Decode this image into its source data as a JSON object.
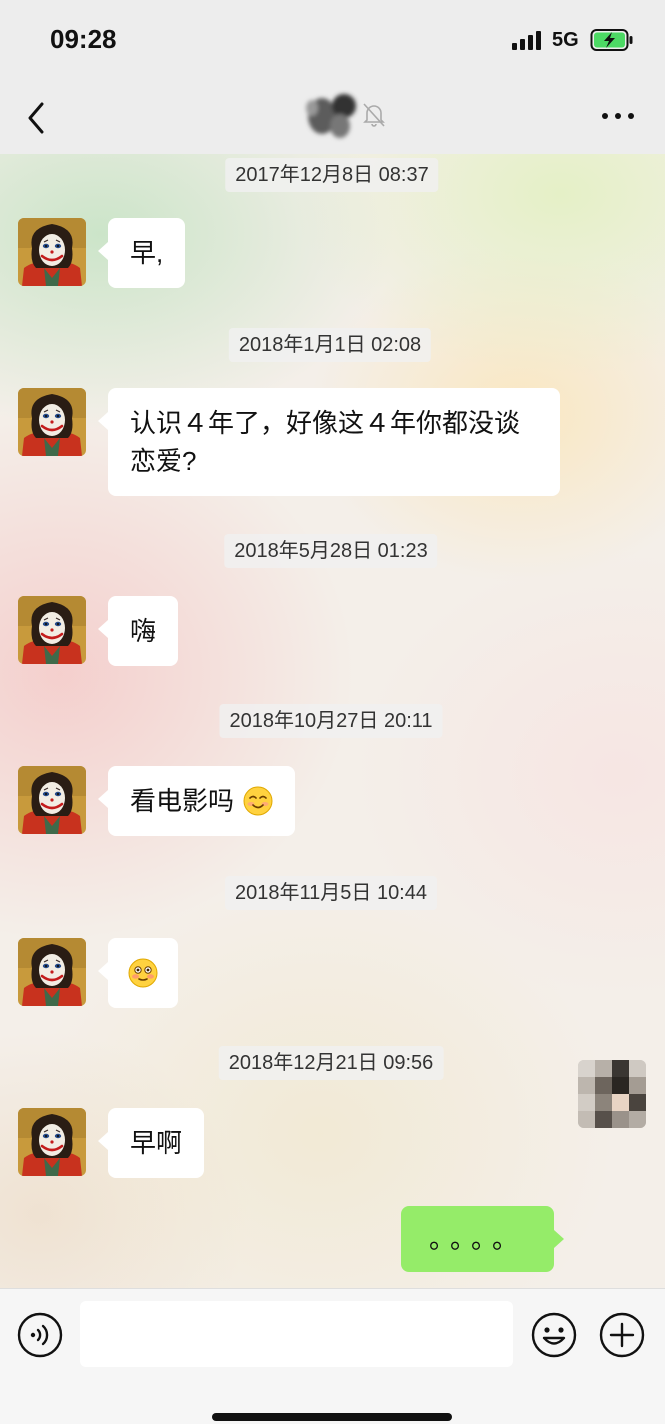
{
  "status_bar": {
    "time": "09:28",
    "network": "5G",
    "icons": [
      "signal-icon",
      "battery-charging-icon"
    ]
  },
  "nav_bar": {
    "icons": [
      "back-icon",
      "mute-icon",
      "more-icon"
    ]
  },
  "messages": [
    {
      "timestamp": "2017年12月8日 08:37",
      "text": "早,"
    },
    {
      "timestamp": "2018年1月1日 02:08",
      "text_line1": "认识４年了，好像这４年你都没谈",
      "text_line2": "恋爱?"
    },
    {
      "timestamp": "2018年5月28日 01:23",
      "text": "嗨"
    },
    {
      "timestamp": "2018年10月27日 20:11",
      "text": "看电影吗",
      "emoji": "smiling-face-icon"
    },
    {
      "timestamp": "2018年11月5日 10:44",
      "emoji": "flushed-face-icon"
    },
    {
      "timestamp": "2018年12月21日 09:56",
      "text": "早啊"
    }
  ],
  "my_message": {
    "text": "。。。。"
  },
  "input_bar": {
    "placeholder": "",
    "icons": [
      "voice-icon",
      "emoji-icon",
      "plus-icon"
    ]
  },
  "colors": {
    "my_bubble": "#95ec69",
    "their_bubble": "#ffffff",
    "bar_background": "#ededed"
  }
}
